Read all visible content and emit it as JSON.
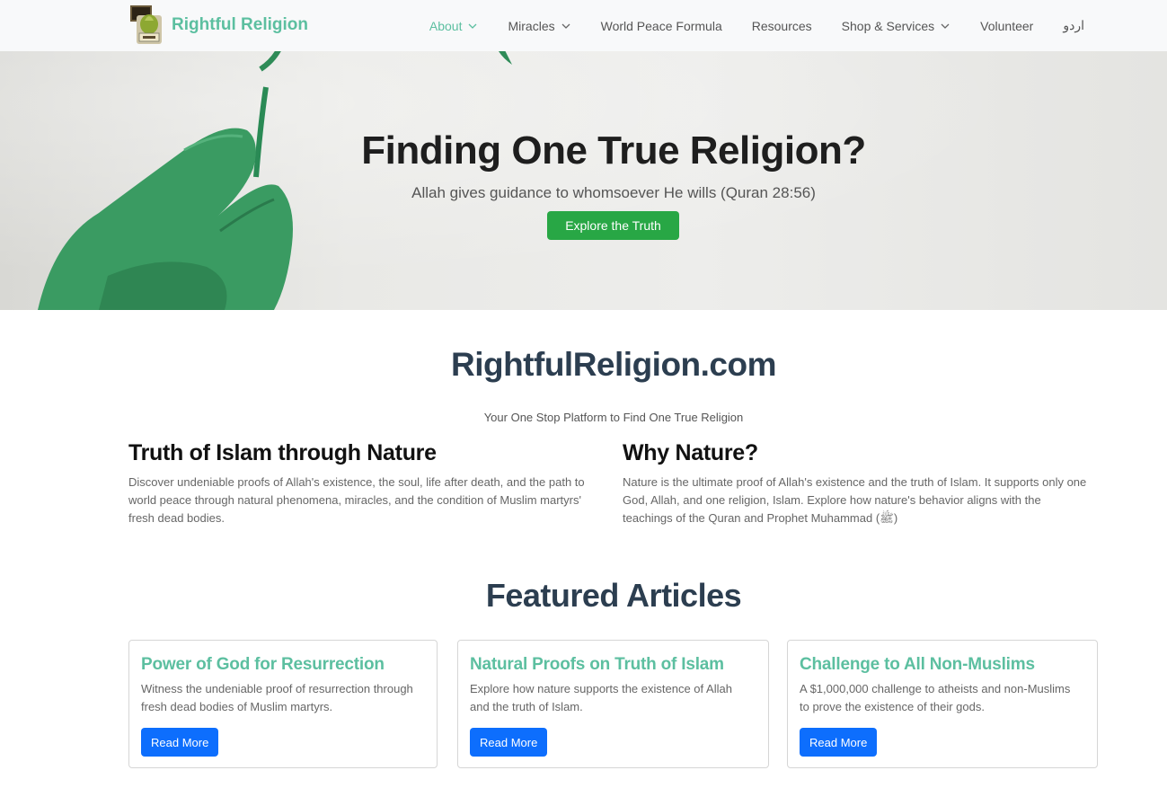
{
  "brand": {
    "name": "Rightful Religion"
  },
  "nav": [
    {
      "label": "About",
      "dropdown": true,
      "active": true
    },
    {
      "label": "Miracles",
      "dropdown": true,
      "active": false
    },
    {
      "label": "World Peace Formula",
      "dropdown": false,
      "active": false
    },
    {
      "label": "Resources",
      "dropdown": false,
      "active": false
    },
    {
      "label": "Shop & Services",
      "dropdown": true,
      "active": false
    },
    {
      "label": "Volunteer",
      "dropdown": false,
      "active": false
    },
    {
      "label": "اردو",
      "dropdown": false,
      "active": false
    }
  ],
  "hero": {
    "title": "Finding One True Religion?",
    "subtitle": "Allah gives guidance to whomsoever He wills (Quran 28:56)",
    "button": "Explore the Truth"
  },
  "intro": {
    "title": "RightfulReligion.com",
    "tagline": "Your One Stop Platform to Find One True Religion",
    "columns": [
      {
        "heading": "Truth of Islam through Nature",
        "text": "Discover undeniable proofs of Allah's existence, the soul, life after death, and the path to world peace through natural phenomena, miracles, and the condition of Muslim martyrs' fresh dead bodies."
      },
      {
        "heading": "Why Nature?",
        "text": "Nature is the ultimate proof of Allah's existence and the truth of Islam. It supports only one God, Allah, and one religion, Islam. Explore how nature's behavior aligns with the teachings of the Quran and Prophet Muhammad (ﷺ)"
      }
    ]
  },
  "featured": {
    "title": "Featured Articles",
    "cards": [
      {
        "title": "Power of God for Resurrection",
        "text": "Witness the undeniable proof of resurrection through fresh dead bodies of Muslim martyrs.",
        "button": "Read More"
      },
      {
        "title": "Natural Proofs on Truth of Islam",
        "text": "Explore how nature supports the existence of Allah and the truth of Islam.",
        "button": "Read More"
      },
      {
        "title": "Challenge to All Non-Muslims",
        "text": "A $1,000,000 challenge to atheists and non-Muslims to prove the existence of their gods.",
        "button": "Read More"
      }
    ]
  },
  "colors": {
    "accent": "#5cbfa0",
    "primary": "#0d6efd",
    "success": "#28a745",
    "heading": "#2c3e50"
  }
}
